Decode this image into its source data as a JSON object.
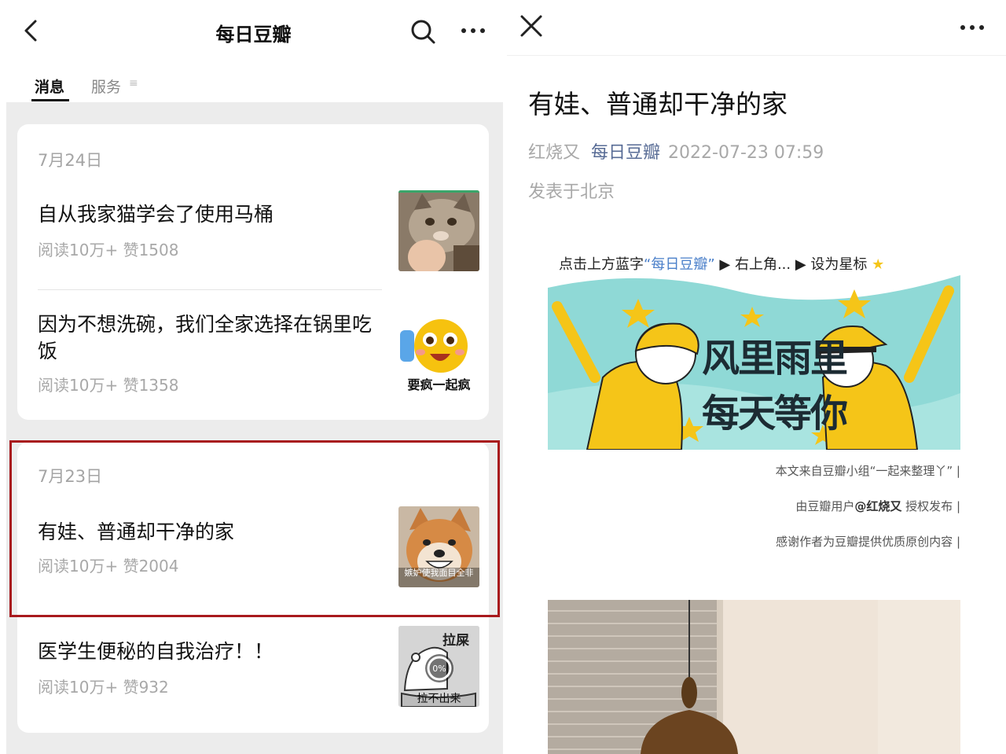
{
  "left": {
    "title": "每日豆瓣",
    "tabs": {
      "messages": "消息",
      "services": "服务"
    },
    "groups": [
      {
        "date": "7月24日",
        "articles": [
          {
            "title": "自从我家猫学会了使用马桶",
            "meta": "阅读10万+  赞1508",
            "thumb": "cat-photo"
          },
          {
            "title": "因为不想洗碗，我们全家选择在锅里吃饭",
            "meta": "阅读10万+  赞1358",
            "thumb": "emoji-sticker",
            "thumb_caption": "要疯一起疯"
          }
        ]
      },
      {
        "date": "7月23日",
        "articles": [
          {
            "title": "有娃、普通却干净的家",
            "meta": "阅读10万+  赞2004",
            "thumb": "shiba-photo",
            "thumb_caption": "嫉妒使我面目全非"
          },
          {
            "title": "医学生便秘的自我治疗！！",
            "meta": "阅读10万+  赞932",
            "thumb": "bear-sticker",
            "thumb_caption": "拉不出来",
            "thumb_top": "拉屎",
            "thumb_progress": "0%"
          }
        ]
      }
    ]
  },
  "right": {
    "title": "有娃、普通却干净的家",
    "author": "红烧又",
    "account": "每日豆瓣",
    "datetime": "2022-07-23 07:59",
    "location": "发表于北京",
    "follow_prefix": "点击上方蓝字",
    "follow_account": "“每日豆瓣”",
    "follow_suffix": "▶ 右上角... ▶ 设为星标",
    "banner_line1": "风里雨里",
    "banner_line2": "每天等你",
    "credit1": "本文来自豆瓣小组“一起来整理丫” |",
    "credit2_prefix": "由豆瓣用户",
    "credit2_user": "@红烧又",
    "credit2_suffix": " 授权发布 |",
    "credit3": "感谢作者为豆瓣提供优质原创内容 |"
  },
  "colors": {
    "highlight": "#a8191d",
    "account_link": "#576b95",
    "banner_teal": "#8fd9d6",
    "banner_yellow": "#f5c518"
  }
}
